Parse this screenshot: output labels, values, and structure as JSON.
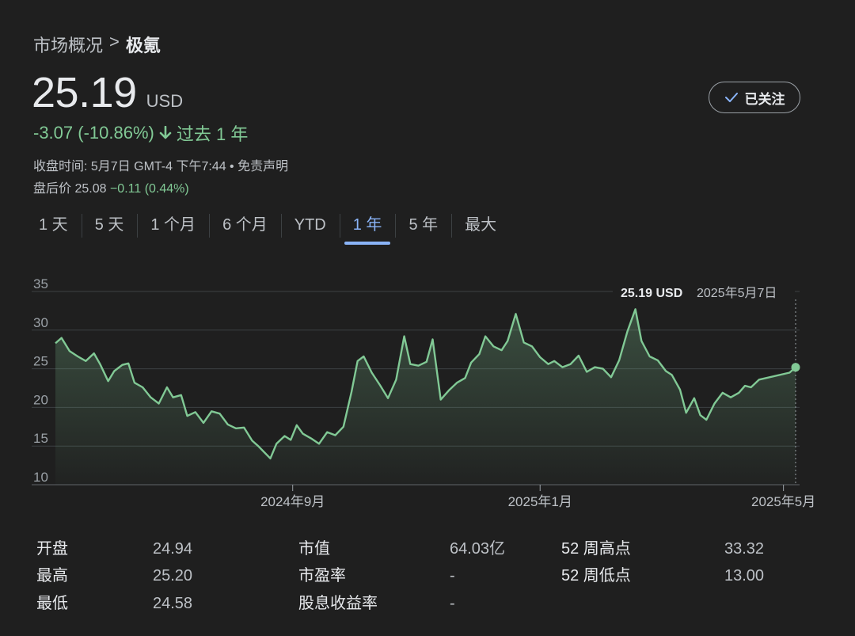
{
  "breadcrumb": {
    "parent": "市场概况",
    "separator": ">",
    "current": "极氪"
  },
  "quote": {
    "price": "25.19",
    "currency": "USD",
    "change": "-3.07 (-10.86%)",
    "period": "过去 1 年",
    "close_info": "收盘时间: 5月7日 GMT-4 下午7:44 • 免责声明",
    "after_hours_label": "盘后价 25.08",
    "after_hours_change": "−0.11 (0.44%)"
  },
  "follow_button": {
    "label": "已关注"
  },
  "tabs": [
    {
      "label": "1 天"
    },
    {
      "label": "5 天"
    },
    {
      "label": "1 个月"
    },
    {
      "label": "6 个月"
    },
    {
      "label": "YTD"
    },
    {
      "label": "1 年",
      "active": true
    },
    {
      "label": "5 年"
    },
    {
      "label": "最大"
    }
  ],
  "colors": {
    "line": "#81c995",
    "accent": "#8ab4f8",
    "background": "#1f1f1f"
  },
  "chart_data": {
    "type": "area",
    "ylim": [
      10,
      35
    ],
    "yticks": [
      35,
      30,
      25,
      20,
      15,
      10
    ],
    "xlim": [
      "2024-05-07",
      "2025-05-07"
    ],
    "xticks": [
      {
        "date": "2024-09-01",
        "label": "2024年9月"
      },
      {
        "date": "2025-01-01",
        "label": "2025年1月"
      },
      {
        "date": "2025-05-01",
        "label": "2025年5月"
      }
    ],
    "grid": true,
    "tooltip": {
      "value": "25.19 USD",
      "date": "2025年5月7日"
    },
    "series": [
      {
        "points": [
          [
            "2024-05-07",
            28.3
          ],
          [
            "2024-05-10",
            29.0
          ],
          [
            "2024-05-14",
            27.3
          ],
          [
            "2024-05-18",
            26.6
          ],
          [
            "2024-05-22",
            26.0
          ],
          [
            "2024-05-26",
            27.0
          ],
          [
            "2024-05-29",
            25.6
          ],
          [
            "2024-06-02",
            23.4
          ],
          [
            "2024-06-05",
            24.7
          ],
          [
            "2024-06-09",
            25.5
          ],
          [
            "2024-06-12",
            25.7
          ],
          [
            "2024-06-15",
            23.2
          ],
          [
            "2024-06-19",
            22.6
          ],
          [
            "2024-06-23",
            21.3
          ],
          [
            "2024-06-27",
            20.5
          ],
          [
            "2024-07-01",
            22.6
          ],
          [
            "2024-07-04",
            21.3
          ],
          [
            "2024-07-08",
            21.6
          ],
          [
            "2024-07-11",
            18.9
          ],
          [
            "2024-07-15",
            19.4
          ],
          [
            "2024-07-19",
            18.0
          ],
          [
            "2024-07-23",
            19.5
          ],
          [
            "2024-07-27",
            19.2
          ],
          [
            "2024-07-31",
            17.8
          ],
          [
            "2024-08-04",
            17.3
          ],
          [
            "2024-08-08",
            17.4
          ],
          [
            "2024-08-12",
            15.7
          ],
          [
            "2024-08-15",
            15.0
          ],
          [
            "2024-08-18",
            14.2
          ],
          [
            "2024-08-21",
            13.4
          ],
          [
            "2024-08-24",
            15.3
          ],
          [
            "2024-08-28",
            16.3
          ],
          [
            "2024-08-31",
            15.8
          ],
          [
            "2024-09-03",
            17.7
          ],
          [
            "2024-09-06",
            16.6
          ],
          [
            "2024-09-10",
            16.0
          ],
          [
            "2024-09-14",
            15.3
          ],
          [
            "2024-09-18",
            16.8
          ],
          [
            "2024-09-22",
            16.4
          ],
          [
            "2024-09-26",
            17.5
          ],
          [
            "2024-09-30",
            22.0
          ],
          [
            "2024-10-03",
            26.0
          ],
          [
            "2024-10-06",
            26.6
          ],
          [
            "2024-10-10",
            24.5
          ],
          [
            "2024-10-14",
            22.9
          ],
          [
            "2024-10-18",
            21.2
          ],
          [
            "2024-10-22",
            23.6
          ],
          [
            "2024-10-26",
            29.2
          ],
          [
            "2024-10-29",
            25.6
          ],
          [
            "2024-11-02",
            25.4
          ],
          [
            "2024-11-06",
            25.9
          ],
          [
            "2024-11-09",
            28.8
          ],
          [
            "2024-11-13",
            21.0
          ],
          [
            "2024-11-17",
            22.2
          ],
          [
            "2024-11-21",
            23.2
          ],
          [
            "2024-11-25",
            23.8
          ],
          [
            "2024-11-28",
            25.8
          ],
          [
            "2024-12-02",
            26.9
          ],
          [
            "2024-12-05",
            29.2
          ],
          [
            "2024-12-09",
            27.9
          ],
          [
            "2024-12-13",
            27.4
          ],
          [
            "2024-12-16",
            28.6
          ],
          [
            "2024-12-20",
            32.1
          ],
          [
            "2024-12-24",
            28.4
          ],
          [
            "2024-12-28",
            27.9
          ],
          [
            "2025-01-01",
            26.5
          ],
          [
            "2025-01-05",
            25.6
          ],
          [
            "2025-01-08",
            26.0
          ],
          [
            "2025-01-12",
            25.2
          ],
          [
            "2025-01-16",
            25.6
          ],
          [
            "2025-01-20",
            26.7
          ],
          [
            "2025-01-24",
            24.6
          ],
          [
            "2025-01-28",
            25.2
          ],
          [
            "2025-02-01",
            25.0
          ],
          [
            "2025-02-05",
            23.9
          ],
          [
            "2025-02-09",
            26.1
          ],
          [
            "2025-02-13",
            29.8
          ],
          [
            "2025-02-17",
            32.7
          ],
          [
            "2025-02-20",
            28.6
          ],
          [
            "2025-02-24",
            26.6
          ],
          [
            "2025-02-28",
            26.1
          ],
          [
            "2025-03-04",
            24.7
          ],
          [
            "2025-03-07",
            24.2
          ],
          [
            "2025-03-11",
            22.3
          ],
          [
            "2025-03-14",
            19.3
          ],
          [
            "2025-03-18",
            21.2
          ],
          [
            "2025-03-21",
            19.0
          ],
          [
            "2025-03-24",
            18.4
          ],
          [
            "2025-03-28",
            20.5
          ],
          [
            "2025-04-01",
            21.9
          ],
          [
            "2025-04-05",
            21.3
          ],
          [
            "2025-04-09",
            21.9
          ],
          [
            "2025-04-12",
            22.8
          ],
          [
            "2025-04-15",
            22.6
          ],
          [
            "2025-04-19",
            23.6
          ],
          [
            "2025-05-04",
            24.5
          ],
          [
            "2025-05-07",
            25.19
          ]
        ]
      }
    ]
  },
  "stats": [
    {
      "label": "开盘",
      "value": "24.94"
    },
    {
      "label": "最高",
      "value": "25.20"
    },
    {
      "label": "最低",
      "value": "24.58"
    },
    {
      "label": "市值",
      "value": "64.03亿"
    },
    {
      "label": "市盈率",
      "value": "-"
    },
    {
      "label": "股息收益率",
      "value": "-"
    },
    {
      "label": "52 周高点",
      "value": "33.32"
    },
    {
      "label": "52 周低点",
      "value": "13.00"
    }
  ]
}
